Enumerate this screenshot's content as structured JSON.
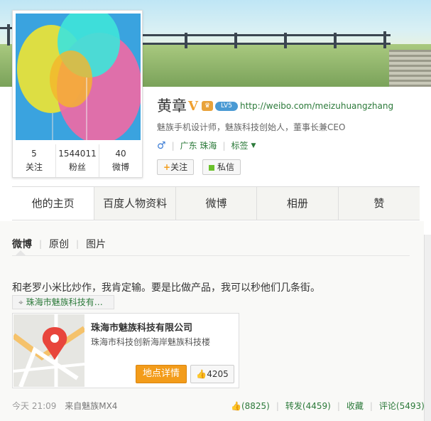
{
  "profile": {
    "name": "黄章",
    "verified_mark": "V",
    "url": "http://weibo.com/meizuhuangzhang",
    "bio": "魅族手机设计师，魅族科技创始人，董事长兼CEO",
    "gender_icon": "male-icon",
    "location": "广东 珠海",
    "tags_label": "标签",
    "level_badge": "LV5",
    "stats": [
      {
        "value": "5",
        "label": "关注"
      },
      {
        "value": "1544011",
        "label": "粉丝"
      },
      {
        "value": "40",
        "label": "微博"
      }
    ],
    "follow_label": "关注",
    "message_label": "私信"
  },
  "tabs": [
    "他的主页",
    "百度人物资料",
    "微博",
    "相册",
    "赞"
  ],
  "subtabs": [
    "微博",
    "原创",
    "图片"
  ],
  "post": {
    "text": "和老罗小米比炒作，我肯定输。要是比做产品，我可以秒他们几条街。",
    "location_chip": "珠海市魅族科技有…",
    "place": {
      "title": "珠海市魅族科技有限公司",
      "address": "珠海市科技创新海岸魅族科技楼",
      "detail_label": "地点详情",
      "likes": "4205"
    },
    "time": "今天 21:09",
    "source": "来自魅族MX4",
    "like_count": "(8825)",
    "repost": "转发(4459)",
    "favorite": "收藏",
    "comment": "评论(5493)"
  },
  "colors": {
    "link_green": "#2c7a3a",
    "accent_orange": "#f39c1a"
  }
}
